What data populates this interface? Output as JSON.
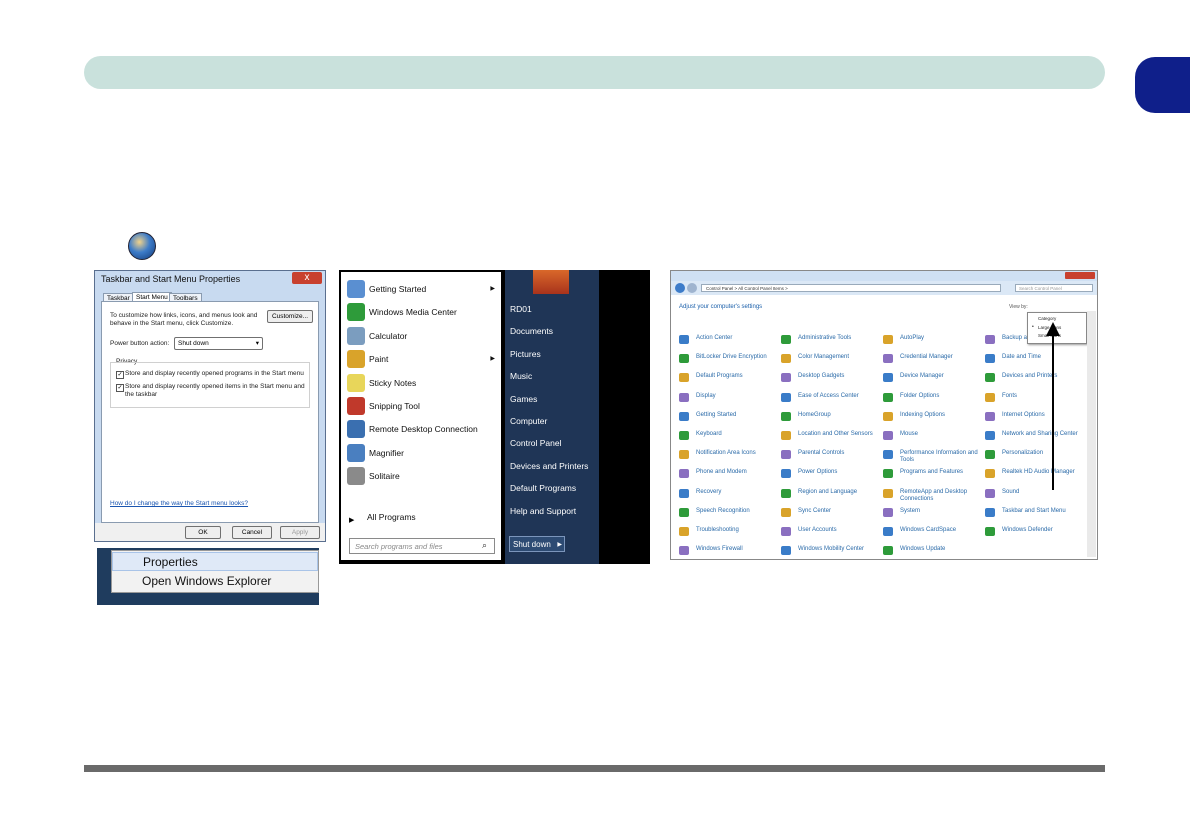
{
  "taskbar_props": {
    "title": "Taskbar and Start Menu Properties",
    "close_glyph": "x",
    "tabs": [
      "Taskbar",
      "Start Menu",
      "Toolbars"
    ],
    "intro": "To customize how links, icons, and menus look and behave in the Start menu, click Customize.",
    "customize_label": "Customize...",
    "power_label": "Power button action:",
    "power_value": "Shut down",
    "privacy_label": "Privacy",
    "check1": "Store and display recently opened programs in the Start menu",
    "check2": "Store and display recently opened items in the Start menu and the taskbar",
    "help_link": "How do I change the way the Start menu looks?",
    "ok_label": "OK",
    "cancel_label": "Cancel",
    "apply_label": "Apply"
  },
  "context_menu": {
    "items": [
      "Properties",
      "Open Windows Explorer"
    ]
  },
  "start_menu": {
    "left_items": [
      {
        "label": "Getting Started",
        "color": "#5a8fd1",
        "arrow": true
      },
      {
        "label": "Windows Media Center",
        "color": "#2e9b3a",
        "arrow": false
      },
      {
        "label": "Calculator",
        "color": "#7b9dbf",
        "arrow": false
      },
      {
        "label": "Paint",
        "color": "#d9a32a",
        "arrow": true
      },
      {
        "label": "Sticky Notes",
        "color": "#e8d65a",
        "arrow": false
      },
      {
        "label": "Snipping Tool",
        "color": "#c0392b",
        "arrow": false
      },
      {
        "label": "Remote Desktop Connection",
        "color": "#3a6fb0",
        "arrow": false
      },
      {
        "label": "Magnifier",
        "color": "#4a7fc0",
        "arrow": false
      },
      {
        "label": "Solitaire",
        "color": "#8a8a8a",
        "arrow": false
      }
    ],
    "all_programs": "All Programs",
    "search_placeholder": "Search programs and files",
    "right_items": [
      "RD01",
      "Documents",
      "Pictures",
      "Music",
      "Games",
      "Computer",
      "Control Panel",
      "Devices and Printers",
      "Default Programs",
      "Help and Support"
    ],
    "shutdown_label": "Shut down"
  },
  "control_panel": {
    "address": "Control Panel > All Control Panel Items >",
    "search_placeholder": "Search Control Panel",
    "heading": "Adjust your computer's settings",
    "view_by": "View by:",
    "dropdown": [
      "Category",
      "Large icons",
      "Small icons"
    ],
    "items": [
      [
        "Action Center",
        "Administrative Tools",
        "AutoPlay",
        "Backup and Restore"
      ],
      [
        "BitLocker Drive Encryption",
        "Color Management",
        "Credential Manager",
        "Date and Time"
      ],
      [
        "Default Programs",
        "Desktop Gadgets",
        "Device Manager",
        "Devices and Printers"
      ],
      [
        "Display",
        "Ease of Access Center",
        "Folder Options",
        "Fonts"
      ],
      [
        "Getting Started",
        "HomeGroup",
        "Indexing Options",
        "Internet Options"
      ],
      [
        "Keyboard",
        "Location and Other Sensors",
        "Mouse",
        "Network and Sharing Center"
      ],
      [
        "Notification Area Icons",
        "Parental Controls",
        "Performance Information and Tools",
        "Personalization"
      ],
      [
        "Phone and Modem",
        "Power Options",
        "Programs and Features",
        "Realtek HD Audio Manager"
      ],
      [
        "Recovery",
        "Region and Language",
        "RemoteApp and Desktop Connections",
        "Sound"
      ],
      [
        "Speech Recognition",
        "Sync Center",
        "System",
        "Taskbar and Start Menu"
      ],
      [
        "Troubleshooting",
        "User Accounts",
        "Windows CardSpace",
        "Windows Defender"
      ],
      [
        "Windows Firewall",
        "Windows Mobility Center",
        "Windows Update",
        ""
      ]
    ],
    "icon_colors": [
      "#3a7cc8",
      "#2e9b3a",
      "#d9a32a",
      "#8a6fc0"
    ]
  }
}
